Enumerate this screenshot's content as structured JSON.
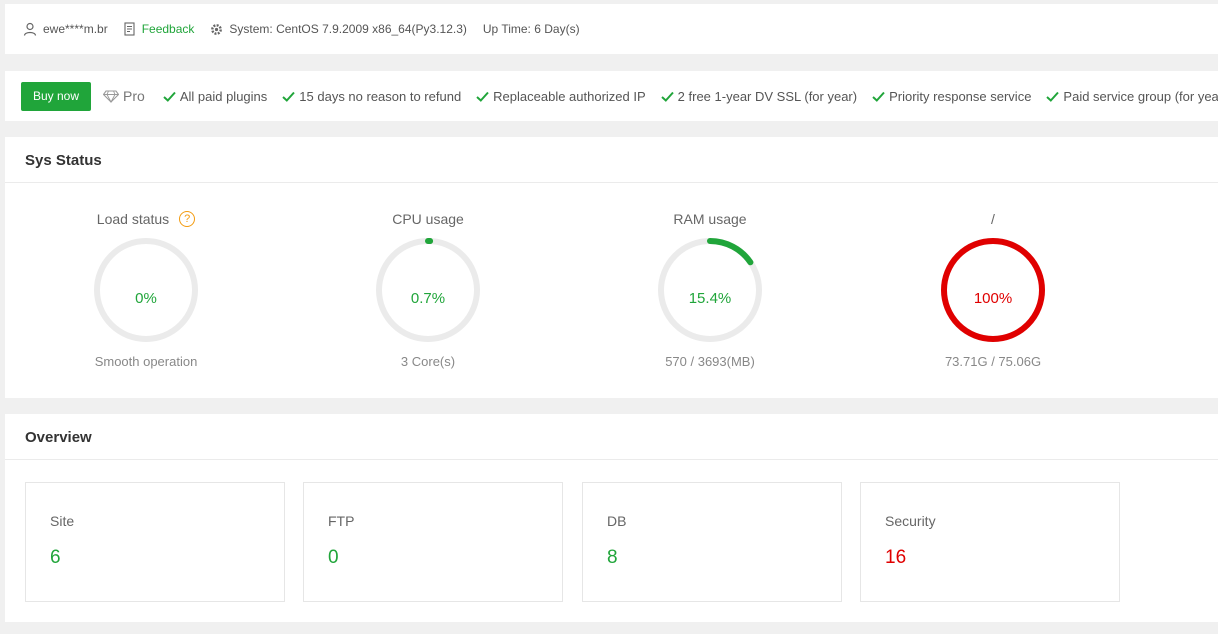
{
  "topbar": {
    "user": "ewe****m.br",
    "feedback": "Feedback",
    "system": "System: CentOS 7.9.2009 x86_64(Py3.12.3)",
    "uptime": "Up Time: 6 Day(s)"
  },
  "probar": {
    "buy_label": "Buy now",
    "pro_label": "Pro",
    "perks": [
      "All paid plugins",
      "15 days no reason to refund",
      "Replaceable authorized IP",
      "2 free 1-year DV SSL (for year)",
      "Priority response service",
      "Paid service group (for year)"
    ]
  },
  "sys_status": {
    "title": "Sys Status",
    "gauges": [
      {
        "label": "Load status",
        "value": "0%",
        "percent": 0,
        "sub": "Smooth operation",
        "color": "#20a53a"
      },
      {
        "label": "CPU usage",
        "value": "0.7%",
        "percent": 0.7,
        "sub": "3 Core(s)",
        "color": "#20a53a"
      },
      {
        "label": "RAM usage",
        "value": "15.4%",
        "percent": 15.4,
        "sub": "570 / 3693(MB)",
        "color": "#20a53a"
      },
      {
        "label": "/",
        "value": "100%",
        "percent": 100,
        "sub": "73.71G / 75.06G",
        "color": "#e00000"
      }
    ]
  },
  "overview": {
    "title": "Overview",
    "cards": [
      {
        "name": "Site",
        "value": "6",
        "color": "#20a53a"
      },
      {
        "name": "FTP",
        "value": "0",
        "color": "#20a53a"
      },
      {
        "name": "DB",
        "value": "8",
        "color": "#20a53a"
      },
      {
        "name": "Security",
        "value": "16",
        "color": "#e00000"
      }
    ]
  },
  "colors": {
    "accent": "#20a53a",
    "danger": "#e00000",
    "track": "#ebebeb"
  }
}
